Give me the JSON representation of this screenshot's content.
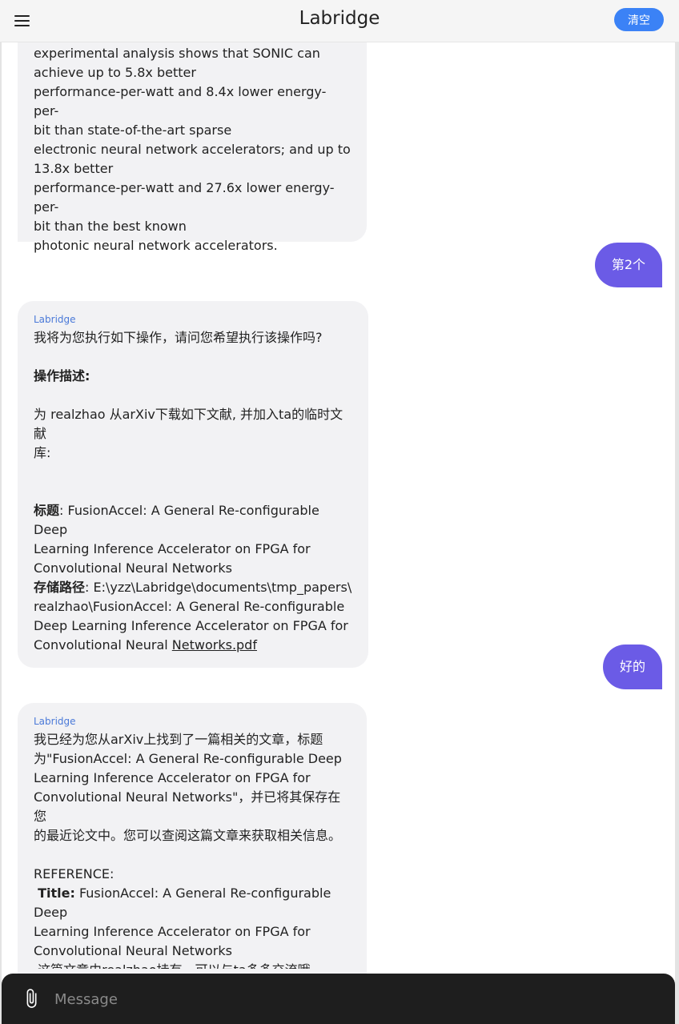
{
  "header": {
    "title": "Labridge",
    "clear_label": "清空"
  },
  "messages": {
    "m1": {
      "lines": [
        "experimental analysis shows that SONIC can",
        "achieve up to 5.8x better",
        "performance-per-watt and 8.4x lower energy-per-",
        "bit than state-of-the-art sparse",
        "electronic neural network accelerators; and up to",
        "13.8x better",
        "performance-per-watt and 27.6x lower energy-per-",
        "bit than the best known",
        "photonic neural network accelerators."
      ]
    },
    "u1": {
      "text": "第2个"
    },
    "m2": {
      "sender": "Labridge",
      "intro": "我将为您执行如下操作，请问您希望执行该操作吗?",
      "desc_heading": "操作描述:",
      "desc_lines": [
        "为 realzhao 从arXiv下载如下文献, 并加入ta的临时文献",
        "库:"
      ],
      "title_label": "标题",
      "title_lines": [
        ": FusionAccel: A General Re-configurable Deep",
        "Learning Inference Accelerator on FPGA for",
        "Convolutional Neural Networks"
      ],
      "path_label": "存储路径",
      "path_lines": [
        ": E:\\yzz\\Labridge\\documents\\tmp_papers\\",
        "realzhao\\FusionAccel: A General Re-configurable",
        "Deep Learning Inference Accelerator on FPGA for"
      ],
      "path_last_prefix": "Convolutional Neural ",
      "path_last_link": "Networks.pdf"
    },
    "u2": {
      "text": "好的"
    },
    "m3": {
      "sender": "Labridge",
      "lines": [
        "我已经为您从arXiv上找到了一篇相关的文章，标题",
        "为\"FusionAccel: A General Re-configurable Deep",
        "Learning Inference Accelerator on FPGA for",
        "Convolutional Neural Networks\"，并已将其保存在您",
        "的最近论文中。您可以查阅这篇文章来获取相关信息。"
      ],
      "ref_heading": "REFERENCE:",
      "ref_title_label": "Title:",
      "ref_title_lines": [
        " FusionAccel: A General Re-configurable Deep",
        "Learning Inference Accelerator on FPGA for",
        "Convolutional Neural Networks"
      ],
      "ref_owner": " 这篇文章由realzhao持有，可以与ta多多交流哦。"
    }
  },
  "input": {
    "placeholder": "Message"
  },
  "colors": {
    "accent_blue": "#3b82f6",
    "user_bubble": "#6b5be6",
    "bot_bubble": "#f2f2f4",
    "input_bar": "#1e1e1e"
  }
}
